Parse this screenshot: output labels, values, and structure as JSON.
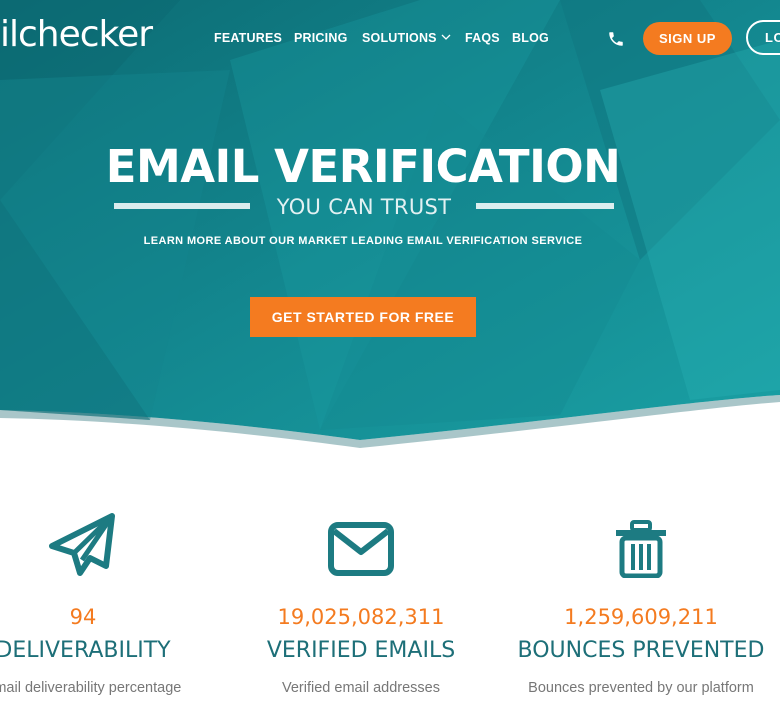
{
  "nav": {
    "logo": "ilchecker",
    "links": [
      "FEATURES",
      "PRICING",
      "SOLUTIONS",
      "FAQS",
      "BLOG"
    ],
    "signup": "SIGN UP",
    "login": "LOGIN"
  },
  "hero": {
    "title": "EMAIL VERIFICATION",
    "subtitle": "YOU CAN TRUST",
    "tagline": "LEARN MORE ABOUT OUR MARKET LEADING EMAIL VERIFICATION SERVICE",
    "cta": "GET STARTED FOR FREE"
  },
  "stats": [
    {
      "icon": "paper-plane-icon",
      "value": "94",
      "label": "DELIVERABILITY",
      "desc": "Email deliverability percentage"
    },
    {
      "icon": "envelope-icon",
      "value": "19,025,082,311",
      "label": "VERIFIED EMAILS",
      "desc": "Verified email addresses"
    },
    {
      "icon": "trash-icon",
      "value": "1,259,609,211",
      "label": "BOUNCES PREVENTED",
      "desc": "Bounces prevented by our platform"
    }
  ],
  "colors": {
    "teal": "#1d8a91",
    "accent": "#f47b20",
    "stat_label": "#1d6f78"
  }
}
